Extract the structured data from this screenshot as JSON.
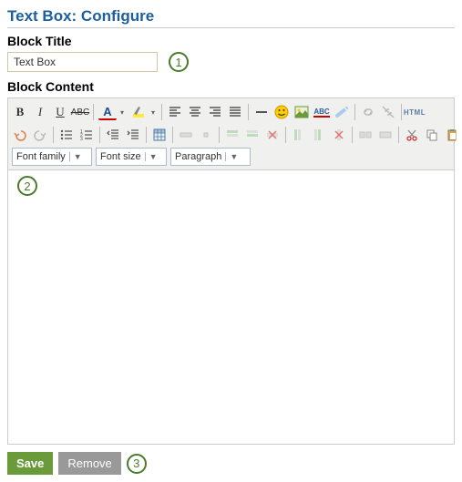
{
  "page": {
    "title": "Text Box: Configure"
  },
  "blockTitle": {
    "label": "Block Title",
    "value": "Text Box"
  },
  "blockContent": {
    "label": "Block Content"
  },
  "callouts": {
    "c1": "1",
    "c2": "2",
    "c3": "3"
  },
  "toolbar": {
    "fontFamily": "Font family",
    "fontSize": "Font size",
    "format": "Paragraph",
    "htmlLabel": "HTML"
  },
  "buttons": {
    "save": "Save",
    "remove": "Remove"
  }
}
